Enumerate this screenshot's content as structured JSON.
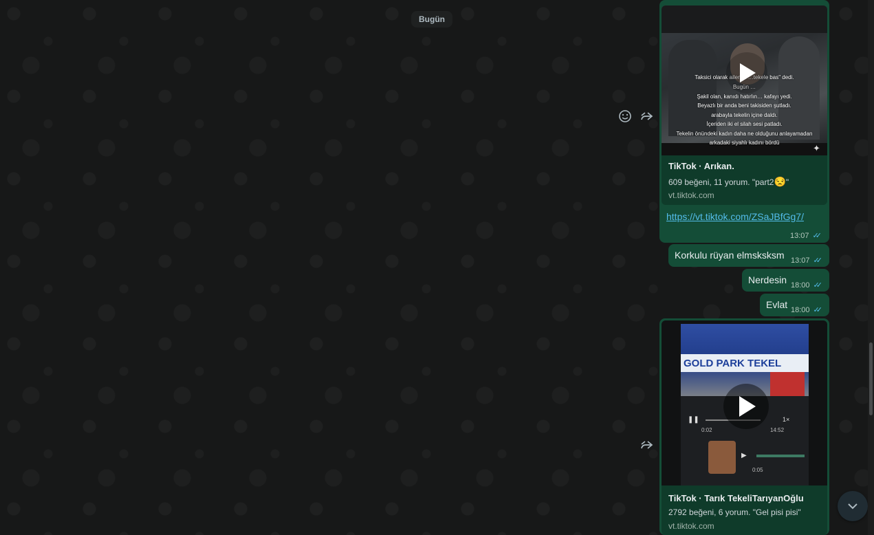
{
  "date_separator": "Bugün",
  "messages": [
    {
      "type": "link_preview",
      "preview_title": "TikTok · Arıkan.",
      "preview_description": "609 beğeni, 11 yorum. \"part2",
      "preview_description_end": "\"",
      "preview_emoji": "😒",
      "preview_domain": "vt.tiktok.com",
      "link": "https://vt.tiktok.com/ZSaJBfGg7/",
      "time": "13:07",
      "thumbnail_caption_lines": [
        "Taksici olarak ailen… …tekele bas\" dedi.",
        "Bugün …",
        "Şakil olan, kanıdı hatırlın… kafayı yedi.",
        "Beyazlı bir anda beni takisiden şutladı.",
        "arabayla tekelin içine daldı.",
        "İçeriden iki el silah sesi patladı.",
        "Tekelin önündeki kadın daha ne olduğunu anlayamadan",
        "arkadaki siyahlı kadını bördü"
      ]
    },
    {
      "type": "text",
      "text": "Korkulu rüyan elmsksksm",
      "time": "13:07"
    },
    {
      "type": "text",
      "text": "Nerdesin",
      "time": "18:00"
    },
    {
      "type": "text",
      "text": "Evlat",
      "time": "18:00"
    },
    {
      "type": "link_preview",
      "preview_title": "TikTok · Tarık TekeliTarıyanOğlu",
      "preview_description": "2792 beğeni, 6 yorum. \"Gel pisi pisi\"",
      "preview_domain": "vt.tiktok.com",
      "thumbnail_sign_text": "GOLD PARK TEKEL",
      "thumbnail_audio_start": "0:02",
      "thumbnail_audio_end": "14:52",
      "thumbnail_audio2_start": "0:05",
      "thumbnail_speed": "1×"
    }
  ],
  "icons": {
    "emoji": "smile-icon",
    "forward": "forward-icon",
    "scroll": "chevron-down-icon",
    "play": "play-icon",
    "ticks": "double-check-icon"
  },
  "colors": {
    "outgoing_bubble": "#144d37",
    "preview_card": "#0f3b2a",
    "read_ticks": "#53bdeb",
    "link": "#53bdeb"
  }
}
